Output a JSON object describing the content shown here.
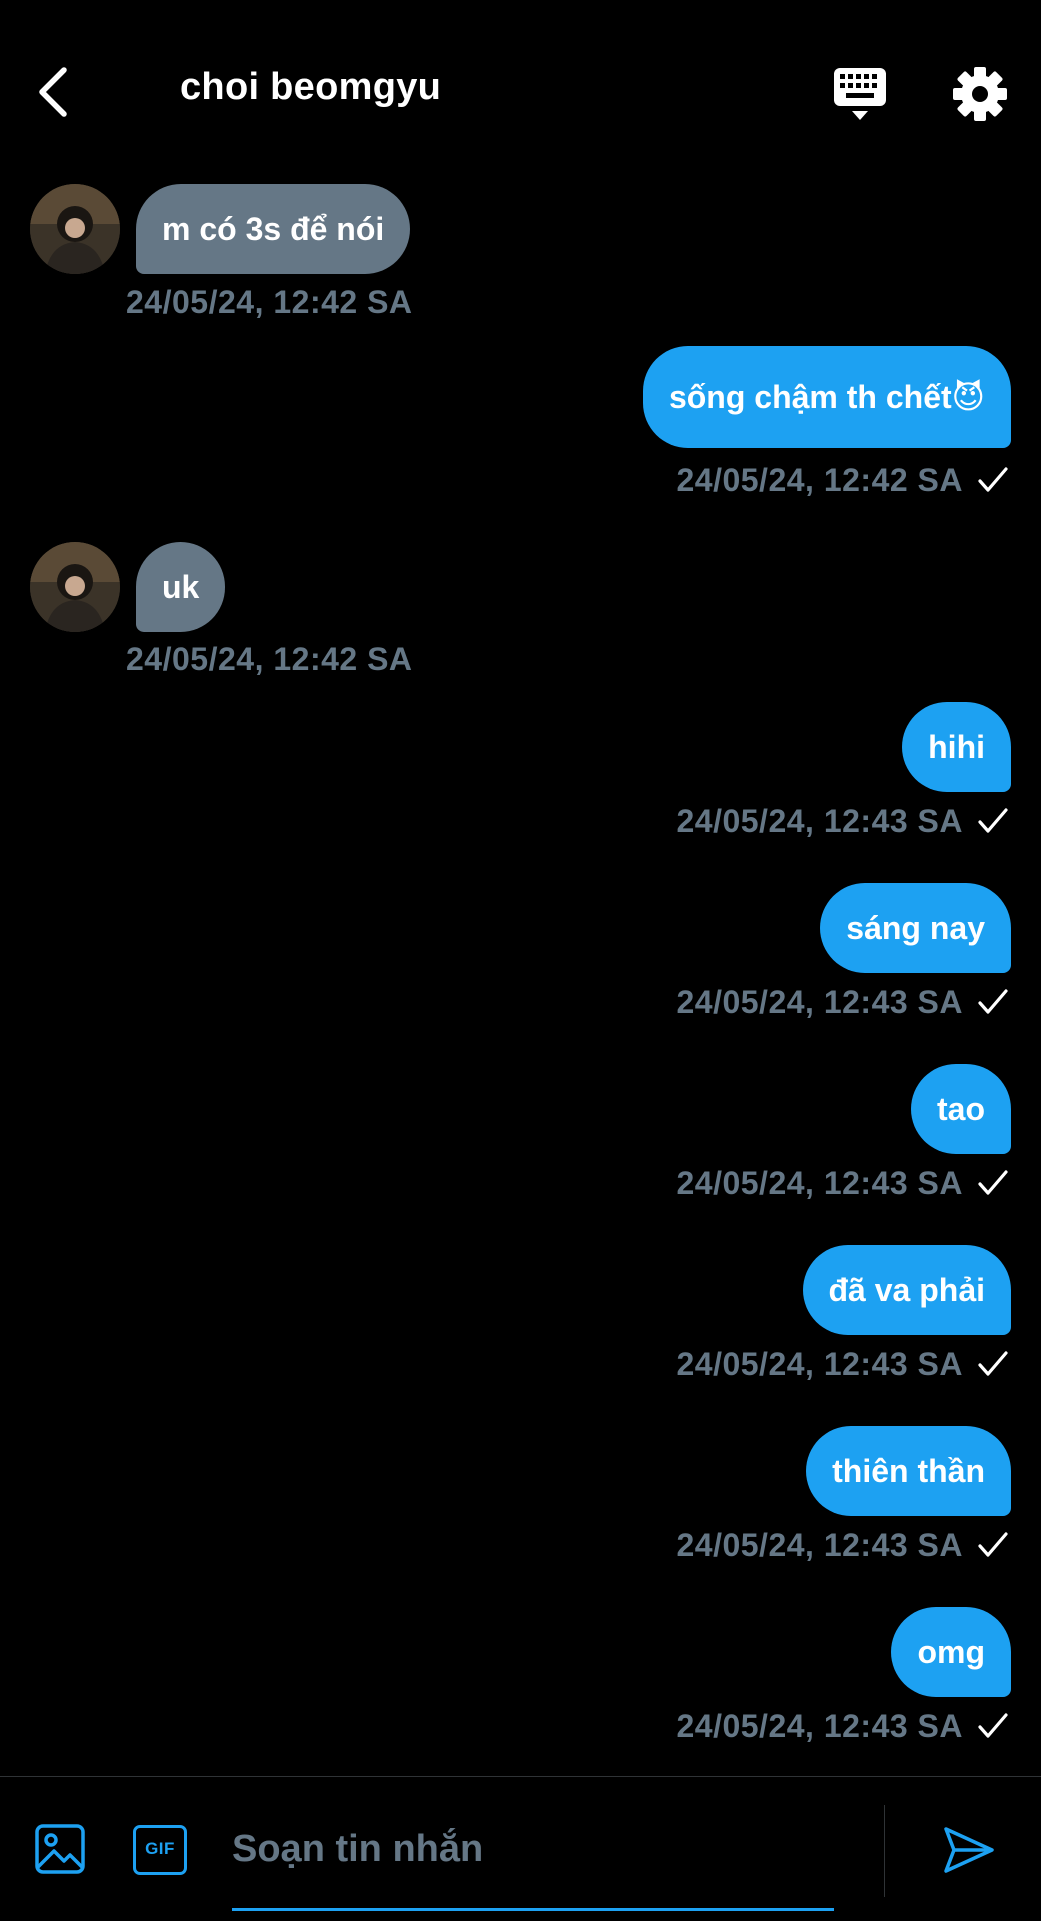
{
  "header": {
    "title": "choi beomgyu",
    "back_icon": "back-arrow-icon",
    "keyboard_icon": "keyboard-icon",
    "settings_icon": "gear-icon"
  },
  "colors": {
    "background": "#000000",
    "outgoing_bubble": "#1da1f2",
    "incoming_bubble": "#657786",
    "timestamp": "#657786",
    "accent": "#1da1f2"
  },
  "messages": [
    {
      "direction": "incoming",
      "text": "m có 3s để nói",
      "time": "24/05/24, 12:42 SA"
    },
    {
      "direction": "outgoing",
      "text": "sống chậm th chết😈",
      "time": "24/05/24, 12:42 SA"
    },
    {
      "direction": "incoming",
      "text": "uk",
      "time": "24/05/24, 12:42 SA"
    },
    {
      "direction": "outgoing",
      "text": "hihi",
      "time": "24/05/24, 12:43 SA"
    },
    {
      "direction": "outgoing",
      "text": "sáng nay",
      "time": "24/05/24, 12:43 SA"
    },
    {
      "direction": "outgoing",
      "text": "tao",
      "time": "24/05/24, 12:43 SA"
    },
    {
      "direction": "outgoing",
      "text": "đã va phải",
      "time": "24/05/24, 12:43 SA"
    },
    {
      "direction": "outgoing",
      "text": "thiên thần",
      "time": "24/05/24, 12:43 SA"
    },
    {
      "direction": "outgoing",
      "text": "omg",
      "time": "24/05/24, 12:43 SA"
    }
  ],
  "composer": {
    "placeholder": "Soạn tin nhắn",
    "value": "",
    "gif_label": "GIF",
    "image_icon": "image-icon",
    "send_icon": "send-icon"
  }
}
